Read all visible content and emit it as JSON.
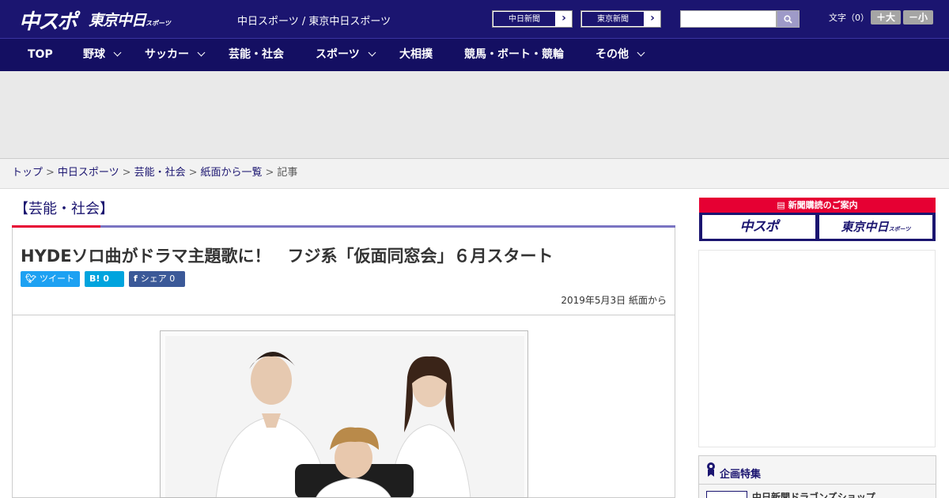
{
  "header": {
    "logo_chusupo": "中スポ",
    "logo_tokyo": "東京中日",
    "logo_tokyo_sub": "スポーツ",
    "site_links": "中日スポーツ / 東京中日スポーツ",
    "paper_buttons": [
      "中日新聞",
      "東京新聞"
    ],
    "search_placeholder": "",
    "font_size_label": "文字（0）",
    "font_big": "＋大",
    "font_small": "－小"
  },
  "nav": {
    "items": [
      {
        "label": "TOP",
        "dropdown": false
      },
      {
        "label": "野球",
        "dropdown": true
      },
      {
        "label": "サッカー",
        "dropdown": true
      },
      {
        "label": "芸能・社会",
        "dropdown": false
      },
      {
        "label": "スポーツ",
        "dropdown": true
      },
      {
        "label": "大相撲",
        "dropdown": false
      },
      {
        "label": "競馬・ボート・競輪",
        "dropdown": false
      },
      {
        "label": "その他",
        "dropdown": true
      }
    ]
  },
  "breadcrumb": {
    "items": [
      "トップ",
      "中日スポーツ",
      "芸能・社会",
      "紙面から一覧"
    ],
    "current": "記事",
    "separator": ">"
  },
  "article": {
    "category": "【芸能・社会】",
    "headline": "HYDEソロ曲がドラマ主題歌に！　フジ系「仮面同窓会」６月スタート",
    "share_tweet": "ツイート",
    "share_hatena_count": "0",
    "share_fb": "シェア",
    "share_fb_count": "0",
    "date": "2019年5月3日 紙面から"
  },
  "sidebar": {
    "subscription_title": "新聞購読のご案内",
    "sub_logo_1": "中スポ",
    "sub_logo_2": "東京中日",
    "sub_logo_2_sub": "スポーツ",
    "feature_title": "企画特集",
    "feature_item": "中日新聞ドラゴンズショップ"
  },
  "colors": {
    "brand_navy": "#1b1570",
    "accent_red": "#e60033",
    "twitter": "#1da1f2",
    "hatena": "#00a4de",
    "facebook": "#3b5998"
  }
}
